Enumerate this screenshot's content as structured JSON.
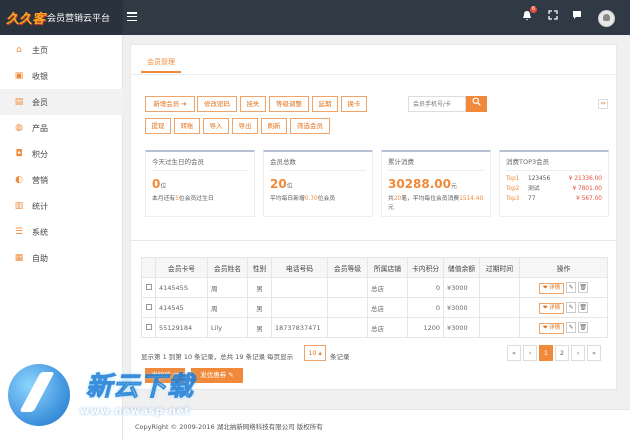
{
  "header": {
    "logo_text": "久久客",
    "brand": "会员营销云平台",
    "notify_count": "6"
  },
  "sidebar": {
    "items": [
      {
        "label": "主页",
        "icon": "home-icon",
        "glyph": "⌂"
      },
      {
        "label": "收银",
        "icon": "cashier-icon",
        "glyph": "▣"
      },
      {
        "label": "会员",
        "icon": "member-icon",
        "glyph": "▤"
      },
      {
        "label": "产品",
        "icon": "product-icon",
        "glyph": "◍"
      },
      {
        "label": "积分",
        "icon": "points-icon",
        "glyph": "◘"
      },
      {
        "label": "营销",
        "icon": "marketing-icon",
        "glyph": "◐"
      },
      {
        "label": "统计",
        "icon": "stats-icon",
        "glyph": "▥"
      },
      {
        "label": "系统",
        "icon": "system-icon",
        "glyph": "☰"
      },
      {
        "label": "自助",
        "icon": "self-service-icon",
        "glyph": "▦"
      }
    ],
    "active_index": 2
  },
  "panel": {
    "tab": "会员管理",
    "buttons_row1": [
      "新增会员 ➔",
      "修改密码",
      "挂失",
      "等级调整",
      "延期",
      "换卡"
    ],
    "buttons_row2": [
      "提现",
      "转账",
      "导入",
      "导出",
      "刷新",
      "筛选会员"
    ],
    "search_placeholder": "会员手机号/卡",
    "search_icon": "search-icon",
    "collapse_glyph": "⇔"
  },
  "stats": {
    "birthday": {
      "title": "今天过生日的会员",
      "num": "0",
      "unit": "位",
      "desc_pre": "本月还有",
      "desc_hl": "5",
      "desc_post": "位会员过生日"
    },
    "total": {
      "title": "会员总数",
      "num": "20",
      "unit": "位",
      "desc_pre": "平均每日新增",
      "desc_hl": "0.70",
      "desc_post": "位会员"
    },
    "consume": {
      "title": "累计消费",
      "num": "30288.00",
      "unit": "元",
      "desc_pre": "共",
      "desc_hl": "20",
      "desc_mid": "笔，平均每位会员消费",
      "desc_hl2": "1514.40",
      "desc_post": "元"
    },
    "top3": {
      "title": "消费TOP3会员",
      "rows": [
        {
          "rank": "Top1",
          "name": "123456",
          "money": "¥ 21336.00"
        },
        {
          "rank": "Top2",
          "name": "测试",
          "money": "¥ 7801.00"
        },
        {
          "rank": "Top3",
          "name": "77",
          "money": "¥ 567.00"
        }
      ]
    }
  },
  "table": {
    "headers": [
      "",
      "会员卡号",
      "会员姓名",
      "性别",
      "电话号码",
      "会员等级",
      "所属店铺",
      "卡内积分",
      "储值余额",
      "过期时间",
      "操作"
    ],
    "rows": [
      [
        "",
        "414545S",
        "周",
        "男",
        "",
        "",
        "总店",
        "0",
        "¥3000",
        "",
        ""
      ],
      [
        "",
        "414545",
        "周",
        "男",
        "",
        "",
        "总店",
        "0",
        "¥3000",
        "",
        ""
      ],
      [
        "",
        "55129184",
        "Lily",
        "男",
        "18737837471",
        "",
        "总店",
        "1200",
        "¥3000",
        "",
        ""
      ]
    ],
    "op_detail": "❤ 详情",
    "op_edit": "✎",
    "op_delete": "🗑"
  },
  "pagination": {
    "info": "显示第 1 到第 10 条记录，总共 19 条记录 每页显示",
    "page_size": "10 ▴",
    "records": "条记录",
    "buttons": [
      "«",
      "‹",
      "1",
      "2",
      "›",
      "»"
    ],
    "current": "1"
  },
  "actions": {
    "send_sms": "发短信 ✉",
    "send_coupon": "发优惠券 ✎"
  },
  "footer": {
    "copyright": "CopyRight © 2009-2016 湖北纳新网络科技有限公司 版权所有"
  },
  "watermark": {
    "title": "新云下载",
    "url": "www.newasp.net"
  },
  "colors": {
    "accent": "#f08a3a",
    "topbar": "#2f3a45",
    "money": "#e74c3c"
  }
}
